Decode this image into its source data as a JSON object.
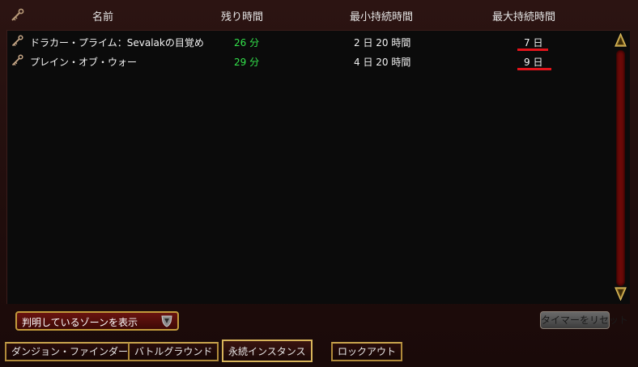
{
  "columns": {
    "name": "名前",
    "remaining": "残り時間",
    "min_duration": "最小持続時間",
    "max_duration": "最大持続時間"
  },
  "rows": [
    {
      "name": "ドラカー・プライム：Sevalakの目覚め",
      "remaining": "26 分",
      "min_duration": "2 日 20 時間",
      "max_duration": "7 日",
      "max_underlined": true
    },
    {
      "name": "プレイン・オブ・ウォー",
      "remaining": "29 分",
      "min_duration": "4 日 20 時間",
      "max_duration": "9 日",
      "max_underlined": true
    }
  ],
  "filter_dropdown": {
    "selected": "判明しているゾーンを表示"
  },
  "reset_button": "タイマーをリセット",
  "tabs": [
    {
      "label": "ダンジョン・ファインダー",
      "active": false
    },
    {
      "label": "バトルグラウンド",
      "active": false
    },
    {
      "label": "永続インスタンス",
      "active": true
    },
    {
      "label": "ロックアウト",
      "active": false
    }
  ],
  "colors": {
    "remaining_text": "#33e24b",
    "underline_mark": "#e2141b",
    "frame_gold": "#c29a3c"
  },
  "icons": [
    "key-icon",
    "shield-icon",
    "scroll-up-icon",
    "scroll-down-icon"
  ]
}
